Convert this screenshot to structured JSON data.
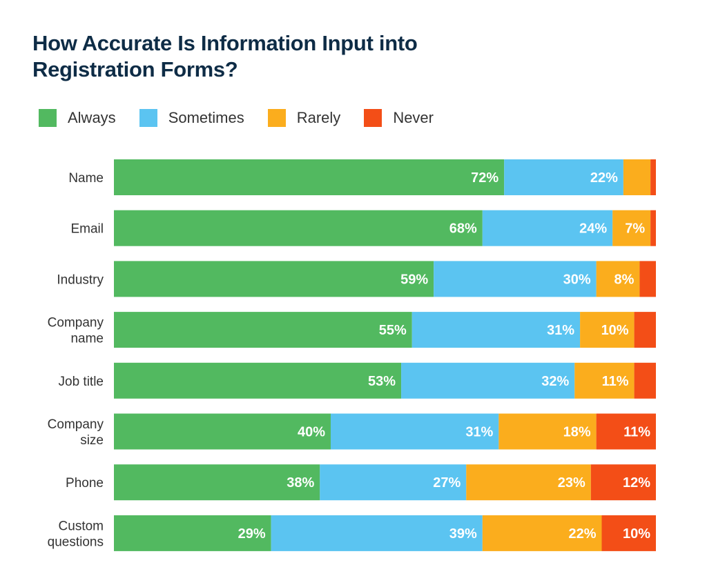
{
  "chart_data": {
    "type": "bar",
    "orientation": "horizontal",
    "stacked": true,
    "title": "How Accurate Is Information Input into Registration Forms?",
    "title_lines": [
      "How Accurate Is Information Input into",
      "Registration Forms?"
    ],
    "xlabel": "",
    "ylabel": "",
    "xlim": [
      0,
      100
    ],
    "grid": false,
    "legend_position": "top-left",
    "categories": [
      [
        "Name"
      ],
      [
        "Email"
      ],
      [
        "Industry"
      ],
      [
        "Company",
        "name"
      ],
      [
        "Job title"
      ],
      [
        "Company",
        "size"
      ],
      [
        "Phone"
      ],
      [
        "Custom",
        "questions"
      ]
    ],
    "series": [
      {
        "name": "Always",
        "color": "#52b960",
        "values": [
          72,
          68,
          59,
          55,
          53,
          40,
          38,
          29
        ],
        "labels": [
          "72%",
          "68%",
          "59%",
          "55%",
          "53%",
          "40%",
          "38%",
          "29%"
        ]
      },
      {
        "name": "Sometimes",
        "color": "#5bc4f1",
        "values": [
          22,
          24,
          30,
          31,
          32,
          31,
          27,
          39
        ],
        "labels": [
          "22%",
          "24%",
          "30%",
          "31%",
          "32%",
          "31%",
          "27%",
          "39%"
        ]
      },
      {
        "name": "Rarely",
        "color": "#fbad1d",
        "values": [
          5,
          7,
          8,
          10,
          11,
          18,
          23,
          22
        ],
        "labels": [
          "",
          "7%",
          "8%",
          "10%",
          "11%",
          "18%",
          "23%",
          "22%"
        ]
      },
      {
        "name": "Never",
        "color": "#f34e17",
        "values": [
          1,
          1,
          3,
          4,
          4,
          11,
          12,
          10
        ],
        "labels": [
          "",
          "",
          "",
          "",
          "",
          "11%",
          "12%",
          "10%"
        ]
      }
    ]
  }
}
